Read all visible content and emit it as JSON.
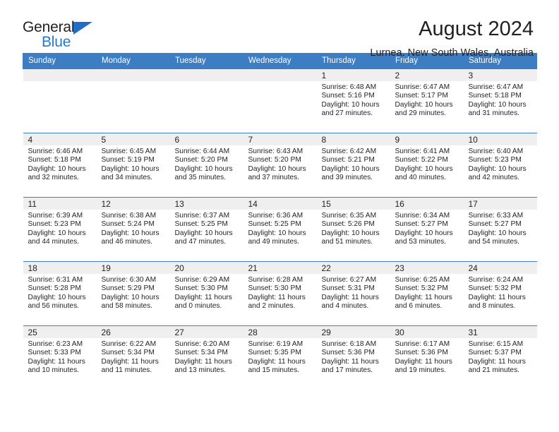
{
  "brand": {
    "name_part1": "General",
    "name_part2": "Blue",
    "triangle_color": "#1f6fc4",
    "blue_color": "#1f7ad4"
  },
  "header": {
    "title": "August 2024",
    "subtitle": "Lurnea, New South Wales, Australia"
  },
  "theme": {
    "header_bg": "#3c7dc4",
    "daynum_band_bg": "#efefef",
    "text_color": "#231f20",
    "row_border": "#3c7dc4"
  },
  "weekday_headers": [
    "Sunday",
    "Monday",
    "Tuesday",
    "Wednesday",
    "Thursday",
    "Friday",
    "Saturday"
  ],
  "weeks": [
    [
      {
        "day": "",
        "lines": []
      },
      {
        "day": "",
        "lines": []
      },
      {
        "day": "",
        "lines": []
      },
      {
        "day": "",
        "lines": []
      },
      {
        "day": "1",
        "lines": [
          "Sunrise: 6:48 AM",
          "Sunset: 5:16 PM",
          "Daylight: 10 hours",
          "and 27 minutes."
        ]
      },
      {
        "day": "2",
        "lines": [
          "Sunrise: 6:47 AM",
          "Sunset: 5:17 PM",
          "Daylight: 10 hours",
          "and 29 minutes."
        ]
      },
      {
        "day": "3",
        "lines": [
          "Sunrise: 6:47 AM",
          "Sunset: 5:18 PM",
          "Daylight: 10 hours",
          "and 31 minutes."
        ]
      }
    ],
    [
      {
        "day": "4",
        "lines": [
          "Sunrise: 6:46 AM",
          "Sunset: 5:18 PM",
          "Daylight: 10 hours",
          "and 32 minutes."
        ]
      },
      {
        "day": "5",
        "lines": [
          "Sunrise: 6:45 AM",
          "Sunset: 5:19 PM",
          "Daylight: 10 hours",
          "and 34 minutes."
        ]
      },
      {
        "day": "6",
        "lines": [
          "Sunrise: 6:44 AM",
          "Sunset: 5:20 PM",
          "Daylight: 10 hours",
          "and 35 minutes."
        ]
      },
      {
        "day": "7",
        "lines": [
          "Sunrise: 6:43 AM",
          "Sunset: 5:20 PM",
          "Daylight: 10 hours",
          "and 37 minutes."
        ]
      },
      {
        "day": "8",
        "lines": [
          "Sunrise: 6:42 AM",
          "Sunset: 5:21 PM",
          "Daylight: 10 hours",
          "and 39 minutes."
        ]
      },
      {
        "day": "9",
        "lines": [
          "Sunrise: 6:41 AM",
          "Sunset: 5:22 PM",
          "Daylight: 10 hours",
          "and 40 minutes."
        ]
      },
      {
        "day": "10",
        "lines": [
          "Sunrise: 6:40 AM",
          "Sunset: 5:23 PM",
          "Daylight: 10 hours",
          "and 42 minutes."
        ]
      }
    ],
    [
      {
        "day": "11",
        "lines": [
          "Sunrise: 6:39 AM",
          "Sunset: 5:23 PM",
          "Daylight: 10 hours",
          "and 44 minutes."
        ]
      },
      {
        "day": "12",
        "lines": [
          "Sunrise: 6:38 AM",
          "Sunset: 5:24 PM",
          "Daylight: 10 hours",
          "and 46 minutes."
        ]
      },
      {
        "day": "13",
        "lines": [
          "Sunrise: 6:37 AM",
          "Sunset: 5:25 PM",
          "Daylight: 10 hours",
          "and 47 minutes."
        ]
      },
      {
        "day": "14",
        "lines": [
          "Sunrise: 6:36 AM",
          "Sunset: 5:25 PM",
          "Daylight: 10 hours",
          "and 49 minutes."
        ]
      },
      {
        "day": "15",
        "lines": [
          "Sunrise: 6:35 AM",
          "Sunset: 5:26 PM",
          "Daylight: 10 hours",
          "and 51 minutes."
        ]
      },
      {
        "day": "16",
        "lines": [
          "Sunrise: 6:34 AM",
          "Sunset: 5:27 PM",
          "Daylight: 10 hours",
          "and 53 minutes."
        ]
      },
      {
        "day": "17",
        "lines": [
          "Sunrise: 6:33 AM",
          "Sunset: 5:27 PM",
          "Daylight: 10 hours",
          "and 54 minutes."
        ]
      }
    ],
    [
      {
        "day": "18",
        "lines": [
          "Sunrise: 6:31 AM",
          "Sunset: 5:28 PM",
          "Daylight: 10 hours",
          "and 56 minutes."
        ]
      },
      {
        "day": "19",
        "lines": [
          "Sunrise: 6:30 AM",
          "Sunset: 5:29 PM",
          "Daylight: 10 hours",
          "and 58 minutes."
        ]
      },
      {
        "day": "20",
        "lines": [
          "Sunrise: 6:29 AM",
          "Sunset: 5:30 PM",
          "Daylight: 11 hours",
          "and 0 minutes."
        ]
      },
      {
        "day": "21",
        "lines": [
          "Sunrise: 6:28 AM",
          "Sunset: 5:30 PM",
          "Daylight: 11 hours",
          "and 2 minutes."
        ]
      },
      {
        "day": "22",
        "lines": [
          "Sunrise: 6:27 AM",
          "Sunset: 5:31 PM",
          "Daylight: 11 hours",
          "and 4 minutes."
        ]
      },
      {
        "day": "23",
        "lines": [
          "Sunrise: 6:25 AM",
          "Sunset: 5:32 PM",
          "Daylight: 11 hours",
          "and 6 minutes."
        ]
      },
      {
        "day": "24",
        "lines": [
          "Sunrise: 6:24 AM",
          "Sunset: 5:32 PM",
          "Daylight: 11 hours",
          "and 8 minutes."
        ]
      }
    ],
    [
      {
        "day": "25",
        "lines": [
          "Sunrise: 6:23 AM",
          "Sunset: 5:33 PM",
          "Daylight: 11 hours",
          "and 10 minutes."
        ]
      },
      {
        "day": "26",
        "lines": [
          "Sunrise: 6:22 AM",
          "Sunset: 5:34 PM",
          "Daylight: 11 hours",
          "and 11 minutes."
        ]
      },
      {
        "day": "27",
        "lines": [
          "Sunrise: 6:20 AM",
          "Sunset: 5:34 PM",
          "Daylight: 11 hours",
          "and 13 minutes."
        ]
      },
      {
        "day": "28",
        "lines": [
          "Sunrise: 6:19 AM",
          "Sunset: 5:35 PM",
          "Daylight: 11 hours",
          "and 15 minutes."
        ]
      },
      {
        "day": "29",
        "lines": [
          "Sunrise: 6:18 AM",
          "Sunset: 5:36 PM",
          "Daylight: 11 hours",
          "and 17 minutes."
        ]
      },
      {
        "day": "30",
        "lines": [
          "Sunrise: 6:17 AM",
          "Sunset: 5:36 PM",
          "Daylight: 11 hours",
          "and 19 minutes."
        ]
      },
      {
        "day": "31",
        "lines": [
          "Sunrise: 6:15 AM",
          "Sunset: 5:37 PM",
          "Daylight: 11 hours",
          "and 21 minutes."
        ]
      }
    ]
  ]
}
